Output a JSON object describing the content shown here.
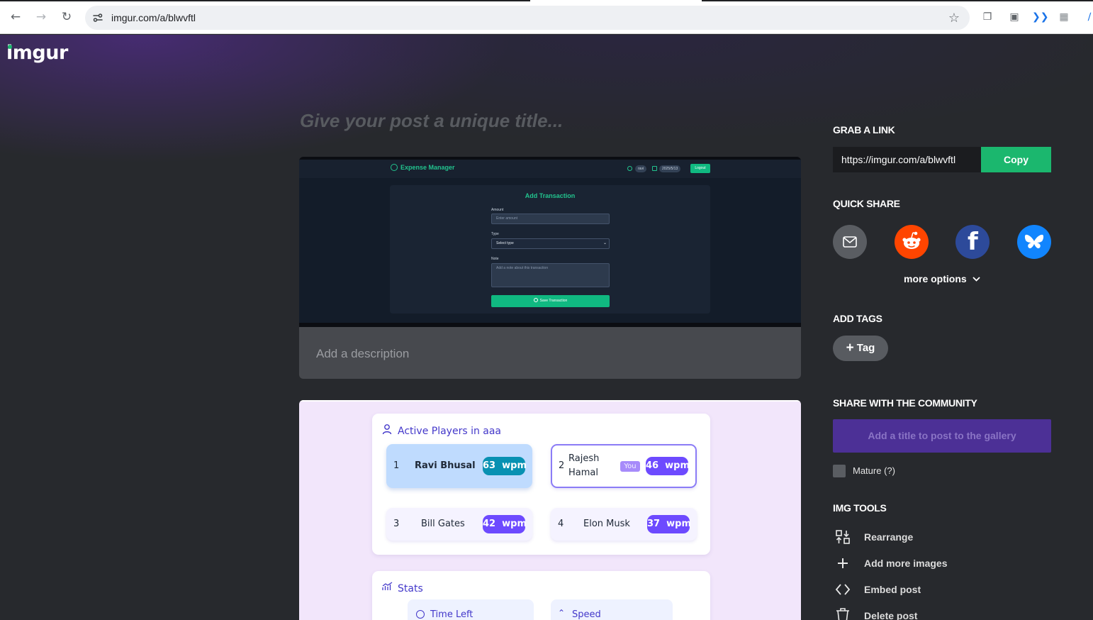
{
  "browser": {
    "url": "imgur.com/a/blwvftl"
  },
  "imgur": {
    "logo": "imgur",
    "title_placeholder": "Give your post a unique title...",
    "description_placeholder": "Add a description"
  },
  "screenshot1": {
    "brand": "Expense Manager",
    "user": "ravi",
    "date": "2025/5/13",
    "logout": "Logout",
    "heading": "Add Transaction",
    "amount_label": "Amount",
    "amount_placeholder": "Enter amount",
    "type_label": "Type",
    "type_placeholder": "Select type",
    "note_label": "Note",
    "note_placeholder": "Add a note about this transaction",
    "save": "Save Transaction"
  },
  "screenshot2": {
    "players_title": "Active Players in aaa",
    "players": [
      {
        "rank": "1",
        "name": "Ravi Bhusal",
        "wpm": "63",
        "unit": "wpm"
      },
      {
        "rank": "2",
        "name_line1": "Rajesh",
        "name_line2": "Hamal",
        "badge": "You",
        "wpm": "46",
        "unit": "wpm"
      },
      {
        "rank": "3",
        "name": "Bill Gates",
        "wpm": "42",
        "unit": "wpm"
      },
      {
        "rank": "4",
        "name": "Elon Musk",
        "wpm": "37",
        "unit": "wpm"
      }
    ],
    "stats_title": "Stats",
    "time_left": "Time Left",
    "speed": "Speed"
  },
  "sidebar": {
    "grab_link": "GRAB A LINK",
    "link": "https://imgur.com/a/blwvftl",
    "copy": "Copy",
    "quick_share": "QUICK SHARE",
    "more_options": "more options",
    "add_tags": "ADD TAGS",
    "tag": "Tag",
    "share_community": "SHARE WITH THE COMMUNITY",
    "post_button": "Add a title to post to the gallery",
    "mature": "Mature (?)",
    "img_tools": "IMG TOOLS",
    "tools": [
      "Rearrange",
      "Add more images",
      "Embed post",
      "Delete post"
    ]
  },
  "colors": {
    "accent_green": "#1bb76e",
    "reddit": "#ff4500",
    "facebook": "#2d4a9a",
    "bluesky": "#1185fe",
    "gallery_purple": "#4c3096"
  },
  "icons": [
    "back-icon",
    "forward-icon",
    "reload-icon",
    "site-settings-icon",
    "star-icon",
    "email-icon",
    "reddit-icon",
    "facebook-icon",
    "bluesky-icon",
    "chevron-down-icon",
    "plus-icon",
    "rearrange-icon",
    "code-icon",
    "trash-icon"
  ]
}
